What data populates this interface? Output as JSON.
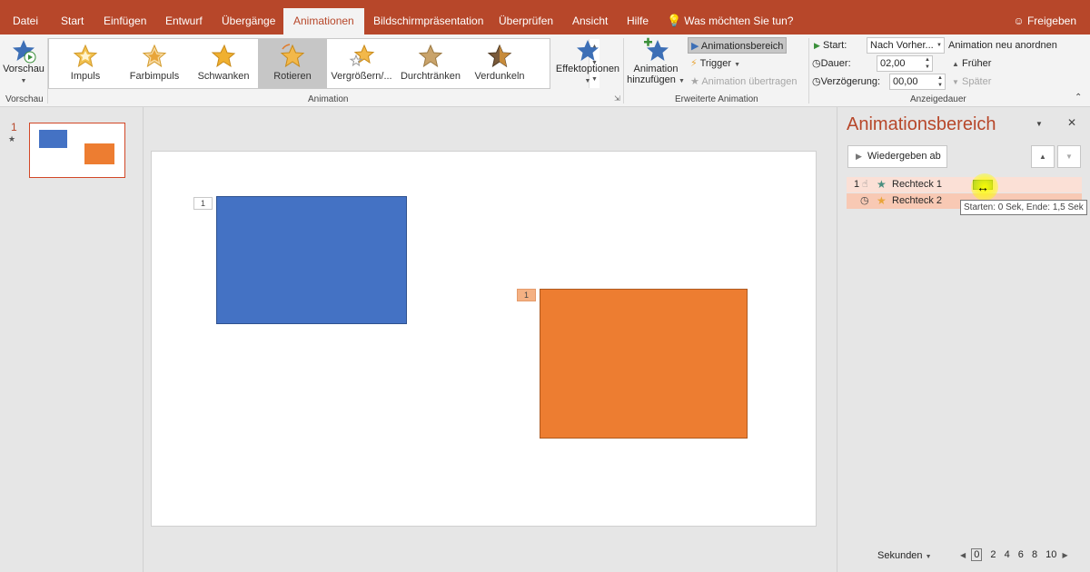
{
  "tabs": [
    "Datei",
    "Start",
    "Einfügen",
    "Entwurf",
    "Übergänge",
    "Animationen",
    "Bildschirmpräsentation",
    "Überprüfen",
    "Ansicht",
    "Hilfe"
  ],
  "active_tab": "Animationen",
  "tell_me": "Was möchten Sie tun?",
  "share": "Freigeben",
  "ribbon": {
    "preview": {
      "label": "Vorschau",
      "group": "Vorschau"
    },
    "gallery": [
      "Impuls",
      "Farbimpuls",
      "Schwanken",
      "Rotieren",
      "Vergrößern/...",
      "Durchtränken",
      "Verdunkeln"
    ],
    "gallery_selected": "Rotieren",
    "effect_options": "Effektoptionen",
    "animation_group": "Animation",
    "add_animation_line1": "Animation",
    "add_animation_line2": "hinzufügen",
    "animation_pane_btn": "Animationsbereich",
    "trigger": "Trigger",
    "animation_painter": "Animation übertragen",
    "advanced_group": "Erweiterte Animation",
    "start_label": "Start:",
    "start_value": "Nach Vorher...",
    "duration_label": "Dauer:",
    "duration_value": "02,00",
    "delay_label": "Verzögerung:",
    "delay_value": "00,00",
    "timing_group": "Anzeigedauer",
    "reorder_title": "Animation neu anordnen",
    "earlier": "Früher",
    "later": "Später"
  },
  "thumbnails": {
    "slide_number": "1"
  },
  "slide": {
    "tag1": "1",
    "tag2": "1"
  },
  "anim_pane": {
    "title": "Animationsbereich",
    "play_from": "Wiedergeben ab",
    "items": [
      {
        "index": "1",
        "name": "Rechteck 1"
      },
      {
        "index": "",
        "name": "Rechteck 2"
      }
    ],
    "tooltip": "Starten: 0 Sek, Ende: 1,5 Sek",
    "seconds_label": "Sekunden",
    "scale": [
      "0",
      "2",
      "4",
      "6",
      "8",
      "10"
    ]
  },
  "colors": {
    "accent": "#b7472a",
    "blue_shape": "#4472c4",
    "orange_shape": "#ed7d31",
    "timing_bar": "#7fb24a"
  }
}
